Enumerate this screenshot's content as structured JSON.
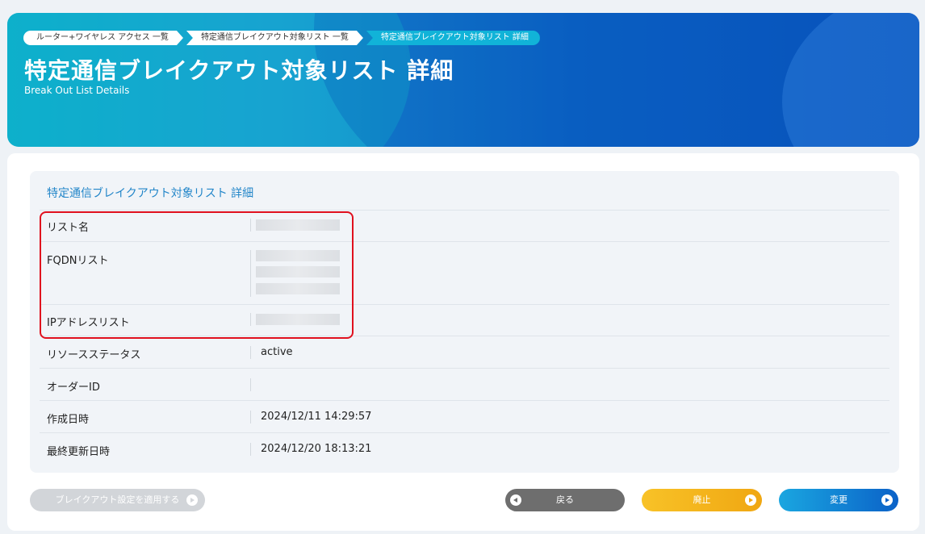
{
  "breadcrumb": [
    {
      "label": "ルーター+ワイヤレス アクセス 一覧"
    },
    {
      "label": "特定通信ブレイクアウト対象リスト 一覧"
    },
    {
      "label": "特定通信ブレイクアウト対象リスト 詳細"
    }
  ],
  "header": {
    "title": "特定通信ブレイクアウト対象リスト 詳細",
    "subtitle": "Break Out List Details"
  },
  "detail": {
    "section_title": "特定通信ブレイクアウト対象リスト 詳細",
    "rows": [
      {
        "label": "リスト名",
        "value": ""
      },
      {
        "label": "FQDNリスト",
        "value": ""
      },
      {
        "label": "IPアドレスリスト",
        "value": ""
      },
      {
        "label": "リソースステータス",
        "value": "active"
      },
      {
        "label": "オーダーID",
        "value": ""
      },
      {
        "label": "作成日時",
        "value": "2024/12/11 14:29:57"
      },
      {
        "label": "最終更新日時",
        "value": "2024/12/20 18:13:21"
      }
    ]
  },
  "actions": {
    "apply_label": "ブレイクアウト設定を適用する",
    "back_label": "戻る",
    "abolish_label": "廃止",
    "change_label": "変更"
  },
  "colors": {
    "accent": "#2386c9",
    "highlight_border": "#e0101e",
    "back_button": "#6e6e6e",
    "abolish_button": "#f0a712",
    "change_button": "#0b62c8",
    "disabled_button": "#d2d5d9"
  },
  "icons": {
    "arrow_right": "play-circle-right-icon",
    "arrow_left": "play-circle-left-icon"
  }
}
